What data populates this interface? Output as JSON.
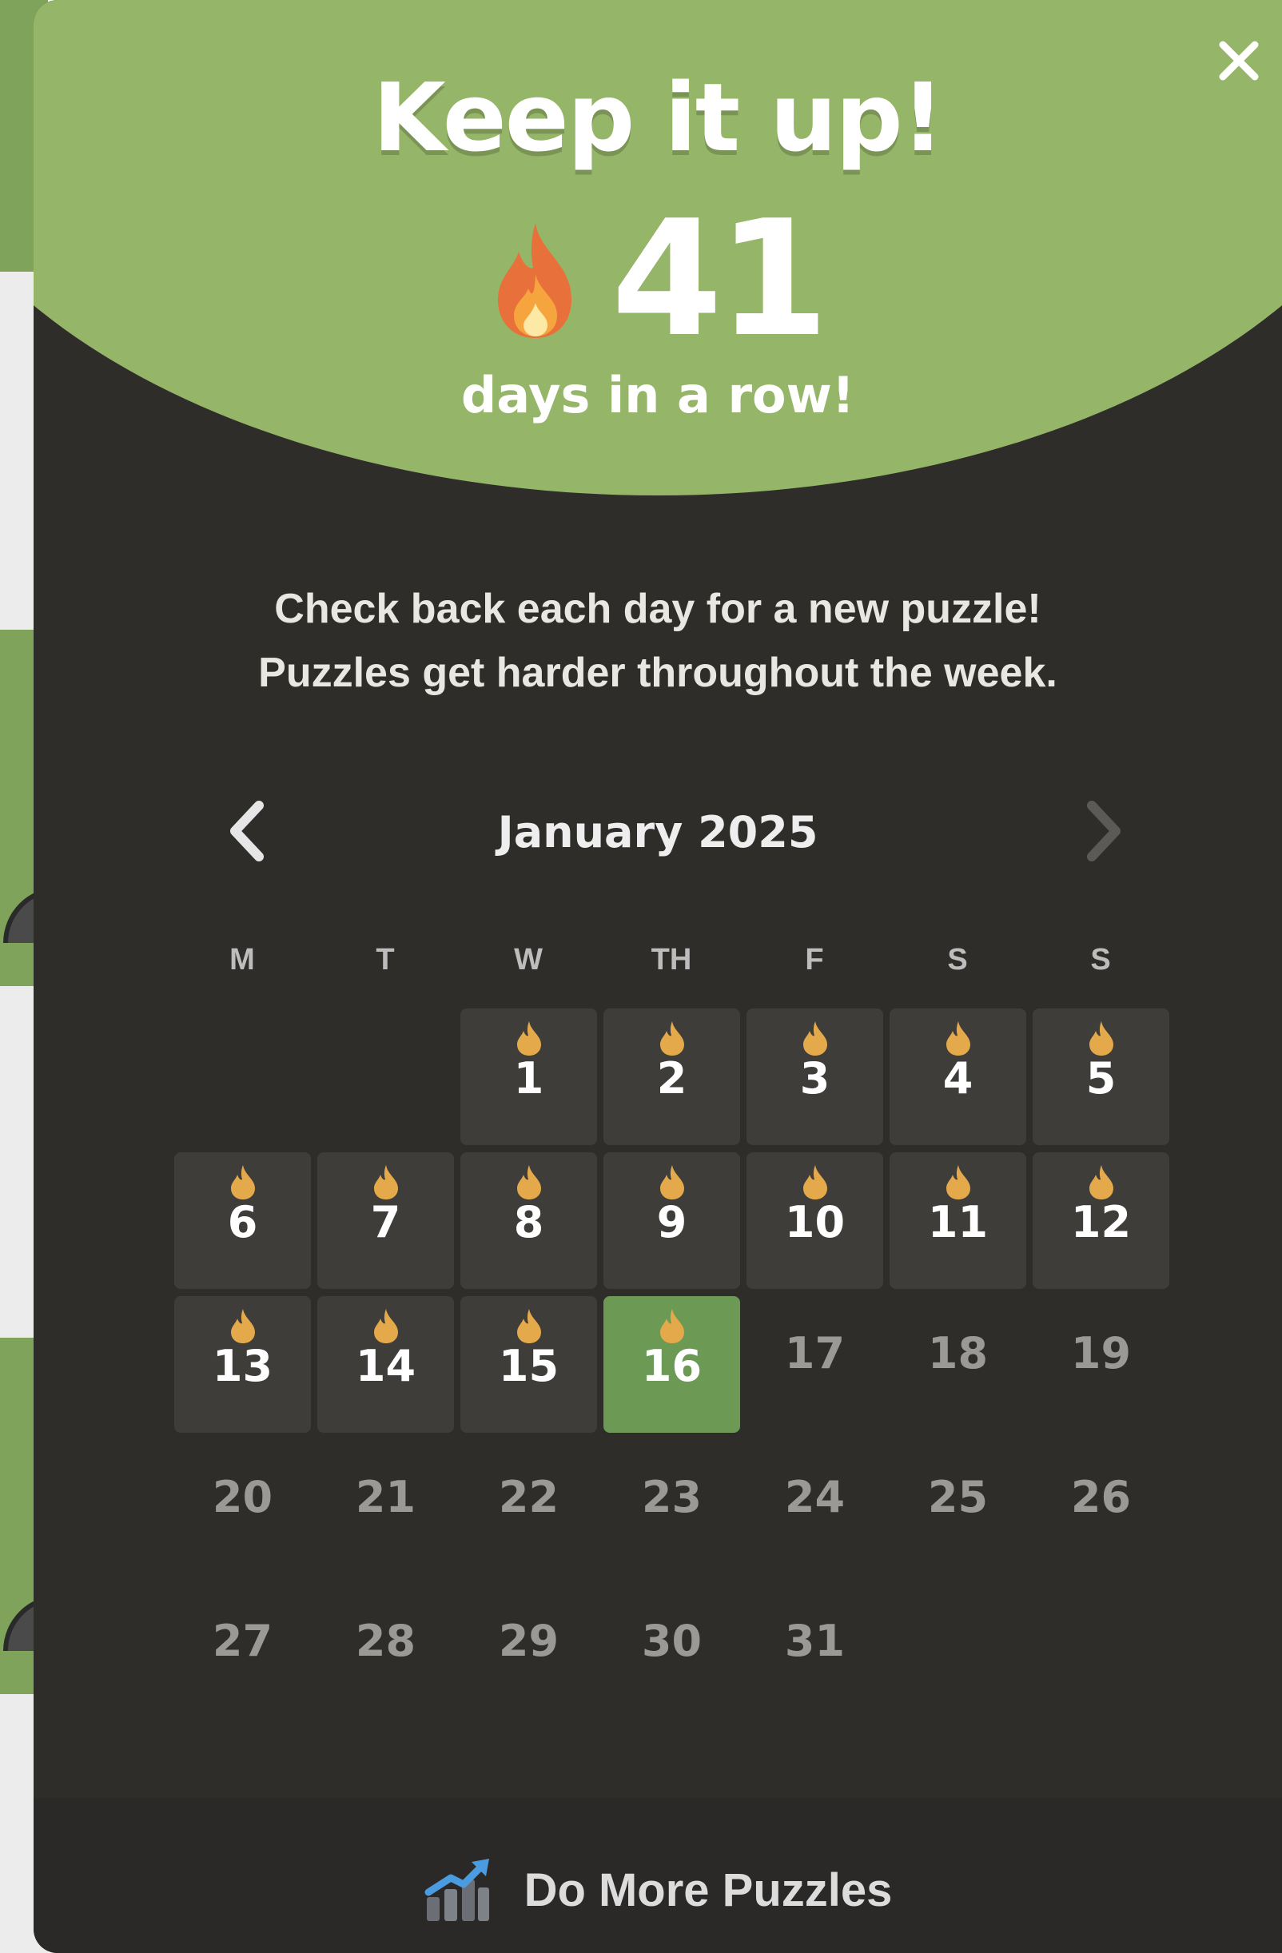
{
  "header": {
    "title": "Keep it up!",
    "streak_count": "41",
    "streak_caption": "days in a row!"
  },
  "message": {
    "line1": "Check back each day for a new puzzle!",
    "line2": "Puzzles get harder throughout the week."
  },
  "calendar": {
    "month_label": "January 2025",
    "weekdays": [
      "M",
      "T",
      "W",
      "TH",
      "F",
      "S",
      "S"
    ],
    "first_weekday_index": 2,
    "days_in_month": 31,
    "completed_days": [
      1,
      2,
      3,
      4,
      5,
      6,
      7,
      8,
      9,
      10,
      11,
      12,
      13,
      14,
      15,
      16
    ],
    "today": 16
  },
  "footer": {
    "more_label": "Do More Puzzles"
  },
  "colors": {
    "hero_green": "#95b568",
    "modal_bg": "#2f2d2a",
    "done_cell": "#3f3d3a",
    "today_cell": "#6c9a55",
    "flame": "#e3a94a",
    "future_text": "#9a9996"
  },
  "icons": {
    "close": "close-icon",
    "streak_fire": "fire-icon",
    "prev": "chevron-left-icon",
    "next": "chevron-right-icon",
    "day_flame": "flame-icon",
    "more": "chart-increasing-icon"
  }
}
